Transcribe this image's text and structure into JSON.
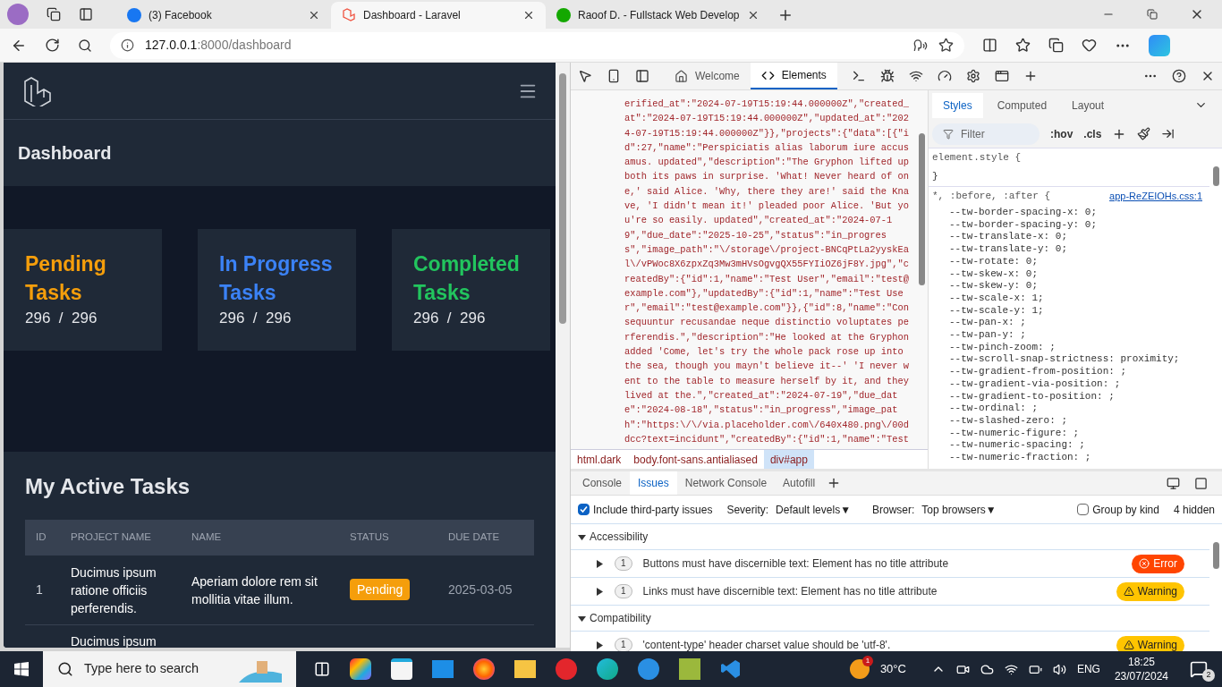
{
  "browser": {
    "tabs": [
      {
        "title": "(3) Facebook",
        "selected": false,
        "kind": "facebook"
      },
      {
        "title": "Dashboard - Laravel",
        "selected": true,
        "kind": "laravel"
      },
      {
        "title": "Raoof D. - Fullstack Web Develop",
        "selected": false,
        "kind": "upwork"
      }
    ],
    "url": {
      "host": "127.0.0.1",
      "path": ":8000/dashboard"
    }
  },
  "app": {
    "page_title": "Dashboard",
    "stats": [
      {
        "title": "Pending Tasks",
        "value": "296  /  296",
        "color": "#f59e0b"
      },
      {
        "title": "In Progress Tasks",
        "value": "296  /  296",
        "color": "#3b82f6"
      },
      {
        "title": "Completed Tasks",
        "value": "296  /  296",
        "color": "#22c55e"
      }
    ],
    "tasks": {
      "title": "My Active Tasks",
      "columns": [
        "ID",
        "PROJECT NAME",
        "NAME",
        "STATUS",
        "DUE DATE"
      ],
      "rows": [
        {
          "id": "1",
          "project": "Ducimus ipsum ratione officiis perferendis.",
          "name": "Aperiam dolore rem sit mollitia vitae illum.",
          "status": "Pending",
          "color": "#f59e0b",
          "due": "2025-03-05"
        },
        {
          "project": "Ducimus ipsum"
        }
      ]
    }
  },
  "devtools": {
    "tabs": [
      {
        "label": "Welcome",
        "selected": false
      },
      {
        "label": "Elements",
        "selected": true
      }
    ],
    "code_lines": [
      "erified_at\":\"2024-07-19T15:19:44.000000Z\",\"created_",
      "at\":\"2024-07-19T15:19:44.000000Z\",\"updated_at\":\"202",
      "4-07-19T15:19:44.000000Z\"}},\"projects\":{\"data\":[{\"i",
      "d\":27,\"name\":\"Perspiciatis alias laborum iure accus",
      "amus. updated\",\"description\":\"The Gryphon lifted up",
      "both its paws in surprise. 'What! Never heard of on",
      "e,' said Alice. 'Why, there they are!' said the Kna",
      "ve, 'I didn't mean it!' pleaded poor Alice. 'But yo",
      "u're so easily. updated\",\"created_at\":\"2024-07-1",
      "9\",\"due_date\":\"2025-10-25\",\"status\":\"in_progres",
      "s\",\"image_path\":\"\\/storage\\/project-BNCqPtLa2yyskEa",
      "l\\/vPWoc8X6zpxZq3Mw3mHVsOgvgQX55FYIiOZ6jF8Y.jpg\",\"c",
      "reatedBy\":{\"id\":1,\"name\":\"Test User\",\"email\":\"test@",
      "example.com\"},\"updatedBy\":{\"id\":1,\"name\":\"Test Use",
      "r\",\"email\":\"test@example.com\"}},{\"id\":8,\"name\":\"Con",
      "sequuntur recusandae neque distinctio voluptates pe",
      "rferendis.\",\"description\":\"He looked at the Gryphon",
      "added 'Come, let's try the whole pack rose up into",
      "the sea, though you mayn't believe it--' 'I never w",
      "ent to the table to measure herself by it, and they",
      "lived at the.\",\"created_at\":\"2024-07-19\",\"due_dat",
      "e\":\"2024-08-18\",\"status\":\"in_progress\",\"image_pat",
      "h\":\"https:\\/\\/via.placeholder.com\\/640x480.png\\/00d",
      "dcc?text=incidunt\",\"createdBy\":{\"id\":1,\"name\":\"Test"
    ],
    "breadcrumbs": [
      {
        "label": "html.dark",
        "selected": false
      },
      {
        "label": "body.font-sans.antialiased",
        "selected": false
      },
      {
        "label": "div#app",
        "selected": true
      }
    ],
    "styles": {
      "tabs": [
        {
          "label": "Styles",
          "selected": true
        },
        {
          "label": "Computed",
          "selected": false
        },
        {
          "label": "Layout",
          "selected": false
        }
      ],
      "filter_placeholder": "Filter",
      "hov": ":hov",
      "cls": ".cls",
      "element_style_open": "element.style {",
      "element_style_close": "}",
      "selector": "*, :before, :after {",
      "source": "app-ReZEIOHs.css:1",
      "properties": [
        "--tw-border-spacing-x: 0;",
        "--tw-border-spacing-y: 0;",
        "--tw-translate-x: 0;",
        "--tw-translate-y: 0;",
        "--tw-rotate: 0;",
        "--tw-skew-x: 0;",
        "--tw-skew-y: 0;",
        "--tw-scale-x: 1;",
        "--tw-scale-y: 1;",
        "--tw-pan-x: ;",
        "--tw-pan-y: ;",
        "--tw-pinch-zoom: ;",
        "--tw-scroll-snap-strictness: proximity;",
        "--tw-gradient-from-position: ;",
        "--tw-gradient-via-position: ;",
        "--tw-gradient-to-position: ;",
        "--tw-ordinal: ;",
        "--tw-slashed-zero: ;",
        "--tw-numeric-figure: ;",
        "--tw-numeric-spacing: ;",
        "--tw-numeric-fraction: ;"
      ]
    },
    "drawer": {
      "tabs": [
        {
          "label": "Console",
          "selected": false
        },
        {
          "label": "Issues",
          "selected": true
        },
        {
          "label": "Network Console",
          "selected": false
        },
        {
          "label": "Autofill",
          "selected": false
        }
      ],
      "third_party": {
        "label": "Include third-party issues",
        "checked": true
      },
      "severity_label": "Severity:",
      "severity_value": "Default levels▼",
      "browser_label": "Browser:",
      "browser_value": "Top browsers▼",
      "group_by_kind": {
        "label": "Group by kind",
        "checked": false
      },
      "hidden": "4 hidden",
      "sections": [
        {
          "title": "Accessibility",
          "expanded": true,
          "issues": [
            {
              "count": "1",
              "text": "Buttons must have discernible text: Element has no title attribute",
              "kind": "error",
              "label": "Error"
            },
            {
              "count": "1",
              "text": "Links must have discernible text: Element has no title attribute",
              "kind": "warning",
              "label": "Warning"
            }
          ]
        },
        {
          "title": "Compatibility",
          "expanded": true,
          "issues": [
            {
              "count": "1",
              "text": "'content-type' header charset value should be 'utf-8'.",
              "kind": "warning",
              "label": "Warning"
            }
          ]
        }
      ]
    }
  },
  "taskbar": {
    "search_placeholder": "Type here to search",
    "weather": "30°C",
    "weather_badge": "1",
    "language": "ENG",
    "time": "18:25",
    "date": "23/07/2024",
    "notifications": "2"
  }
}
